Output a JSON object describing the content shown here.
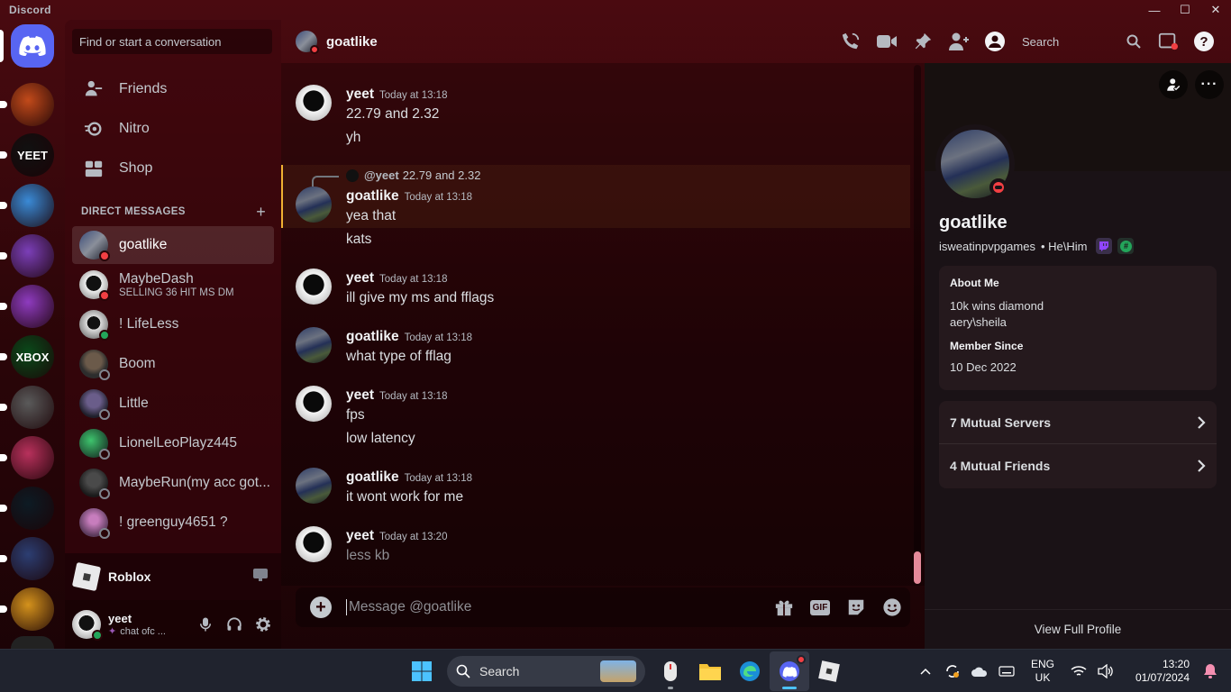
{
  "app_title": "Discord",
  "window_controls": {
    "minimize": "—",
    "maximize": "☐",
    "close": "✕"
  },
  "sidebar": {
    "search_placeholder": "Find or start a conversation",
    "nav": [
      {
        "label": "Friends",
        "icon": "friends-icon"
      },
      {
        "label": "Nitro",
        "icon": "nitro-icon"
      },
      {
        "label": "Shop",
        "icon": "shop-icon"
      }
    ],
    "dm_header": "DIRECT MESSAGES",
    "dm_add": "+",
    "dms": [
      {
        "name": "goatlike",
        "status": "dnd",
        "sub": "",
        "active": true
      },
      {
        "name": "MaybeDash",
        "status": "dnd",
        "sub": "SELLING 36 HIT MS DM"
      },
      {
        "name": "! LifeLess",
        "status": "online",
        "sub": ""
      },
      {
        "name": "Boom",
        "status": "offline",
        "sub": ""
      },
      {
        "name": "Little",
        "status": "offline",
        "sub": ""
      },
      {
        "name": "LionelLeoPlayz445",
        "status": "offline",
        "sub": ""
      },
      {
        "name": "MaybeRun(my acc got...",
        "status": "offline",
        "sub": ""
      },
      {
        "name": "! greenguy4651 ?",
        "status": "offline",
        "sub": ""
      }
    ],
    "activity": {
      "game": "Roblox"
    },
    "user": {
      "name": "yeet",
      "custom_status": "chat ofc ..."
    }
  },
  "servers": {
    "colors": [
      "#c24a1a",
      "#111111",
      "#3a8ad6",
      "#7b3fb8",
      "#8e3bbf",
      "#0a4a1a",
      "#5a5a5a",
      "#b8315c",
      "#0d1b24",
      "#2c3e72",
      "#d4921c"
    ],
    "labels": [
      "",
      "YEET",
      "",
      "",
      "",
      "XBOX",
      "",
      "",
      "",
      "",
      ""
    ]
  },
  "chat": {
    "recipient": "goatlike",
    "header_search": "Search",
    "messages": [
      {
        "author": "yeet",
        "time": "Today at 13:18",
        "lines": [
          "22.79 and 2.32",
          "yh"
        ]
      },
      {
        "author": "goatlike",
        "time": "Today at 13:18",
        "lines": [
          "yea that",
          "kats"
        ],
        "reply_to": {
          "author": "@yeet",
          "text": "22.79 and 2.32"
        }
      },
      {
        "author": "yeet",
        "time": "Today at 13:18",
        "lines": [
          "ill give my ms and fflags"
        ]
      },
      {
        "author": "goatlike",
        "time": "Today at 13:18",
        "lines": [
          "what type of fflag"
        ]
      },
      {
        "author": "yeet",
        "time": "Today at 13:18",
        "lines": [
          "fps",
          "low latency"
        ]
      },
      {
        "author": "goatlike",
        "time": "Today at 13:18",
        "lines": [
          "it wont work for me"
        ]
      },
      {
        "author": "yeet",
        "time": "Today at 13:20",
        "lines": [
          "less kb"
        ],
        "pending": true
      }
    ],
    "composer_placeholder": "Message @goatlike",
    "composer_gif": "GIF"
  },
  "profile": {
    "display_name": "goatlike",
    "username": "isweatinpvpgames",
    "pronouns": "• He\\Him",
    "about_title": "About Me",
    "about_lines": [
      "10k wins diamond",
      "aery\\sheila"
    ],
    "member_since_title": "Member Since",
    "member_since": "10 Dec 2022",
    "mutual_servers": "7 Mutual Servers",
    "mutual_friends": "4 Mutual Friends",
    "view_full": "View Full Profile",
    "badge_hash": "#"
  },
  "taskbar": {
    "search": "Search",
    "lang_top": "ENG",
    "lang_bottom": "UK",
    "time": "13:20",
    "date": "01/07/2024"
  },
  "colors": {
    "accent": "#5865f2",
    "dnd": "#f23f43",
    "online": "#23a55a",
    "reply_highlight": "#f0b132"
  }
}
